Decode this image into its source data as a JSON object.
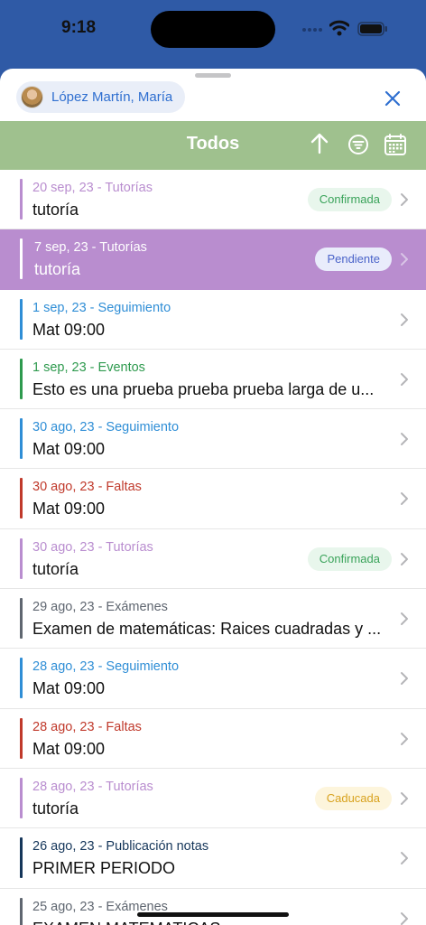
{
  "status": {
    "time": "9:18"
  },
  "user": {
    "name": "López Martín, María"
  },
  "header": {
    "title": "Todos"
  },
  "items": [
    {
      "meta": "20 sep, 23 - Tutorías",
      "title": "tutoría",
      "color": "#b98dcf",
      "badge": "Confirmada",
      "badge_kind": "ok"
    },
    {
      "meta": "7 sep, 23 - Tutorías",
      "title": "tutoría",
      "color": "#ffffff",
      "badge": "Pendiente",
      "badge_kind": "pending",
      "selected": true
    },
    {
      "meta": "1 sep, 23 - Seguimiento",
      "title": "Mat 09:00",
      "color": "#2f8ed6"
    },
    {
      "meta": "1 sep, 23 - Eventos",
      "title": "Esto es una prueba prueba prueba larga de u...",
      "color": "#2e9a4e"
    },
    {
      "meta": "30 ago, 23 - Seguimiento",
      "title": "Mat 09:00",
      "color": "#2f8ed6"
    },
    {
      "meta": "30 ago, 23 - Faltas",
      "title": "Mat 09:00",
      "color": "#c0392b"
    },
    {
      "meta": "30 ago, 23 - Tutorías",
      "title": "tutoría",
      "color": "#b98dcf",
      "badge": "Confirmada",
      "badge_kind": "ok"
    },
    {
      "meta": "29 ago, 23 - Exámenes",
      "title": "Examen de matemáticas: Raices cuadradas y ...",
      "color": "#5f6670"
    },
    {
      "meta": "28 ago, 23 - Seguimiento",
      "title": "Mat 09:00",
      "color": "#2f8ed6"
    },
    {
      "meta": "28 ago, 23 - Faltas",
      "title": "Mat 09:00",
      "color": "#c0392b"
    },
    {
      "meta": "28 ago, 23 - Tutorías",
      "title": "tutoría",
      "color": "#b98dcf",
      "badge": "Caducada",
      "badge_kind": "expired"
    },
    {
      "meta": "26 ago, 23 - Publicación notas",
      "title": "PRIMER PERIODO",
      "color": "#15365a"
    },
    {
      "meta": "25 ago, 23 - Exámenes",
      "title": "EXAMEN MATEMATICAS",
      "color": "#5f6670"
    }
  ],
  "badge_styles": {
    "ok": {
      "bg": "#e8f6ec",
      "fg": "#3aa35a"
    },
    "pending": {
      "bg": "#e9ecfb",
      "fg": "#4a63c9"
    },
    "expired": {
      "bg": "#fdf5dc",
      "fg": "#d8a21e"
    }
  },
  "icons": [
    "sort-ascending-icon",
    "filter-icon",
    "calendar-icon",
    "close-icon",
    "chevron-right-icon"
  ]
}
